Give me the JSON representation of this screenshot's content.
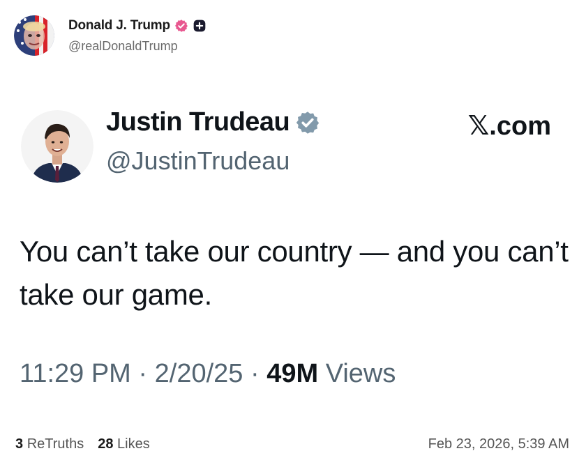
{
  "post": {
    "author_name": "Donald J. Trump",
    "author_handle": "@realDonaldTrump",
    "verified_icon": "verified-badge-icon",
    "plus_icon": "plus-badge-icon",
    "verified_color": "#e8578f"
  },
  "quoted_tweet": {
    "author_name": "Justin Trudeau",
    "author_handle": "@JustinTrudeau",
    "verified_icon": "verified-badge-icon",
    "verified_color": "#829aab",
    "source_label": "𝕏.com",
    "text": "You can’t take our country — and you can’t take our game.",
    "time": "11:29 PM",
    "separator": "·",
    "date": "2/20/25",
    "views_count": "49M",
    "views_label": "Views"
  },
  "footer": {
    "retruths_count": "3",
    "retruths_label": "ReTruths",
    "likes_count": "28",
    "likes_label": "Likes",
    "timestamp": "Feb 23, 2026, 5:39 AM"
  }
}
